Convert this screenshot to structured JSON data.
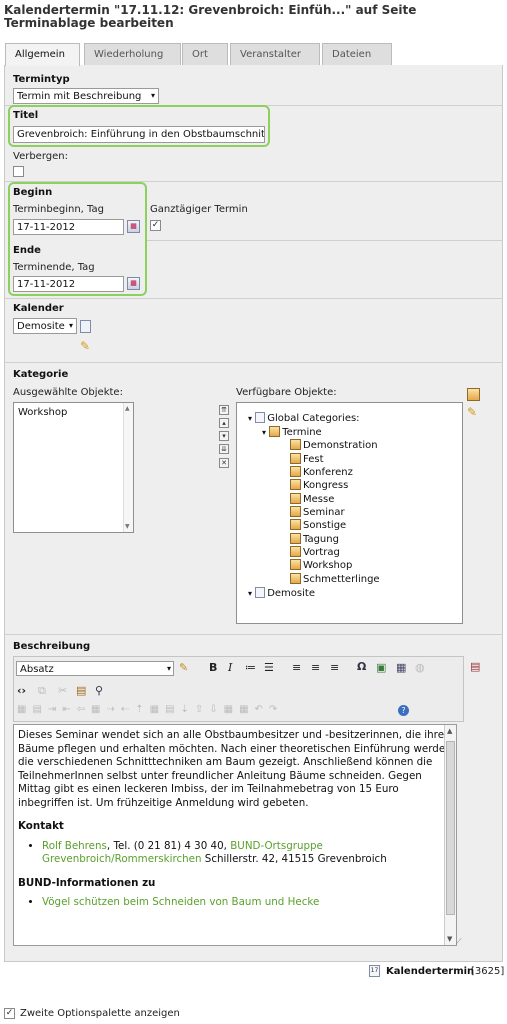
{
  "header": {
    "title": "Kalendertermin \"17.11.12: Grevenbroich: Einfüh...\" auf Seite Terminablage bearbeiten"
  },
  "tabs": [
    "Allgemein",
    "Wiederholung",
    "Ort",
    "Veranstalter",
    "Dateien"
  ],
  "termintyp": {
    "label": "Termintyp",
    "value": "Termin mit Beschreibung"
  },
  "titel": {
    "label": "Titel",
    "value": "Grevenbroich: Einführung in den Obstbaumschnitt"
  },
  "verbergen": {
    "label": "Verbergen:",
    "checked": false
  },
  "beginn": {
    "label": "Beginn",
    "sublabel": "Terminbeginn, Tag",
    "value": "17-11-2012",
    "allday_label": "Ganztägiger Termin",
    "allday_checked": true
  },
  "ende": {
    "label": "Ende",
    "sublabel": "Terminende, Tag",
    "value": "17-11-2012"
  },
  "kalender": {
    "label": "Kalender",
    "value": "Demosite"
  },
  "kategorie": {
    "label": "Kategorie",
    "selected_label": "Ausgewählte Objekte:",
    "available_label": "Verfügbare Objekte:",
    "selected": [
      "Workshop"
    ],
    "tree": {
      "root": "Global Categories:",
      "folder": "Termine",
      "children": [
        "Demonstration",
        "Fest",
        "Konferenz",
        "Kongress",
        "Messe",
        "Seminar",
        "Sonstige",
        "Tagung",
        "Vortrag",
        "Workshop",
        "Schmetterlinge"
      ],
      "second_root": "Demosite"
    }
  },
  "beschreibung": {
    "label": "Beschreibung",
    "format_value": "Absatz",
    "para": "Dieses Seminar wendet sich an alle Obstbaumbesitzer und -besitzerinnen, die ihre Bäume pflegen und erhalten möchten. Nach einer theoretischen Einführung werden die verschiedenen Schnitttechniken am Baum gezeigt. Anschließend können die TeilnehmerInnen selbst unter freundlicher Anleitung Bäume schneiden. Gegen Mittag gibt es einen leckeren Imbiss, der im Teilnahmebetrag von 15 Euro inbegriffen ist. Um frühzeitige Anmeldung wird gebeten.",
    "kontakt_heading": "Kontakt",
    "kontakt_name": "Rolf Behrens",
    "kontakt_tel": ", Tel. (0 21 81) 4 30 40, ",
    "kontakt_org": "BUND-Ortsgruppe Grevenbroich/Rommerskirchen",
    "kontakt_addr": " Schillerstr. 42, 41515 Grevenbroich",
    "info_heading": "BUND-Informationen zu",
    "info_link": "Vögel schützen beim Schneiden von Baum und Hecke"
  },
  "footer": {
    "record_label": "Kalendertermin",
    "record_id": "[3625]",
    "options_label": "Zweite Optionspalette anzeigen",
    "options_checked": true
  }
}
